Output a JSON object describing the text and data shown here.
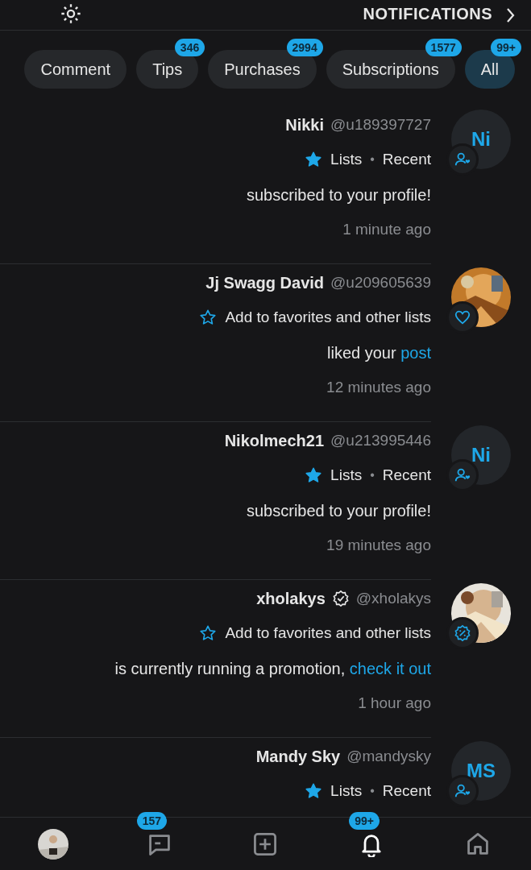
{
  "header": {
    "title": "NOTIFICATIONS"
  },
  "tabs": [
    {
      "label": "Comment",
      "selected": false
    },
    {
      "label": "Tips",
      "badge": "346",
      "selected": false
    },
    {
      "label": "Purchases",
      "badge": "2994",
      "selected": false
    },
    {
      "label": "Subscriptions",
      "badge": "1577",
      "selected": false
    },
    {
      "label": "All",
      "badge": "99+",
      "selected": true
    }
  ],
  "notifications": [
    {
      "name": "Nikki",
      "handle": "@u189397727",
      "verified": false,
      "avatar": {
        "kind": "initials",
        "text": "Ni"
      },
      "kind": "subscription",
      "favorited": true,
      "list_text": "Lists",
      "list_sep": "•",
      "list_name": "Recent",
      "body": "subscribed to your profile!",
      "time": "1 minute ago"
    },
    {
      "name": "Jj Swagg David",
      "handle": "@u209605639",
      "verified": false,
      "kind": "like",
      "favorited": false,
      "list_text": "Add to favorites and other lists",
      "body": "liked your",
      "link": "post",
      "time": "12 minutes ago"
    },
    {
      "name": "Nikolmech21",
      "handle": "@u213995446",
      "verified": false,
      "avatar": {
        "kind": "initials",
        "text": "Ni"
      },
      "kind": "subscription",
      "favorited": true,
      "list_text": "Lists",
      "list_sep": "•",
      "list_name": "Recent",
      "body": "subscribed to your profile!",
      "time": "19 minutes ago"
    },
    {
      "name": "xholakys",
      "handle": "@xholakys",
      "verified": true,
      "kind": "promotion",
      "favorited": false,
      "list_text": "Add to favorites and other lists",
      "body": "is currently running a promotion,",
      "link": "check it out",
      "time": "1 hour ago"
    },
    {
      "name": "Mandy Sky",
      "handle": "@mandysky",
      "verified": false,
      "avatar": {
        "kind": "initials",
        "text": "MS"
      },
      "kind": "subscription",
      "favorited": true,
      "list_text": "Lists",
      "list_sep": "•",
      "list_name": "Recent"
    }
  ],
  "bottom_nav": [
    {
      "kind": "avatar",
      "selected": false
    },
    {
      "kind": "message",
      "badge": "157",
      "selected": false
    },
    {
      "kind": "plus",
      "selected": false
    },
    {
      "kind": "bell",
      "badge": "99+",
      "selected": true
    },
    {
      "kind": "home",
      "selected": false
    }
  ]
}
